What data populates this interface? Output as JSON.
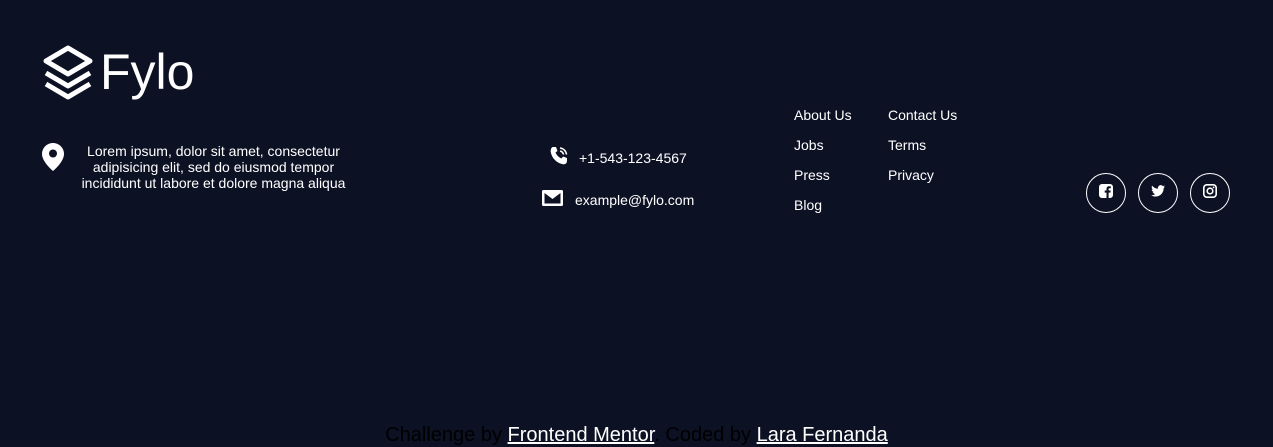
{
  "brand": {
    "logo_text": "Fylo",
    "icon": "fylo-stack-icon"
  },
  "footer": {
    "location": {
      "icon": "location-pin-icon",
      "text": "Lorem ipsum, dolor sit amet, consectetur adipisicing elit, sed do eiusmod tempor incididunt ut labore et dolore magna aliqua"
    },
    "phone": {
      "icon": "phone-icon",
      "text": "+1-543-123-4567"
    },
    "email": {
      "icon": "email-icon",
      "text": "example@fylo.com"
    },
    "links_col1": [
      "About Us",
      "Jobs",
      "Press",
      "Blog"
    ],
    "links_col2": [
      "Contact Us",
      "Terms",
      "Privacy"
    ],
    "socials": [
      {
        "name": "facebook-icon"
      },
      {
        "name": "twitter-icon"
      },
      {
        "name": "instagram-icon"
      }
    ]
  },
  "attribution": {
    "prefix": "Challenge by",
    "challenge_link": "Frontend Mentor",
    "middle": ". Coded by",
    "author_link": "Lara Fernanda"
  },
  "colors": {
    "background": "#0c1124",
    "text": "#ffffff"
  }
}
